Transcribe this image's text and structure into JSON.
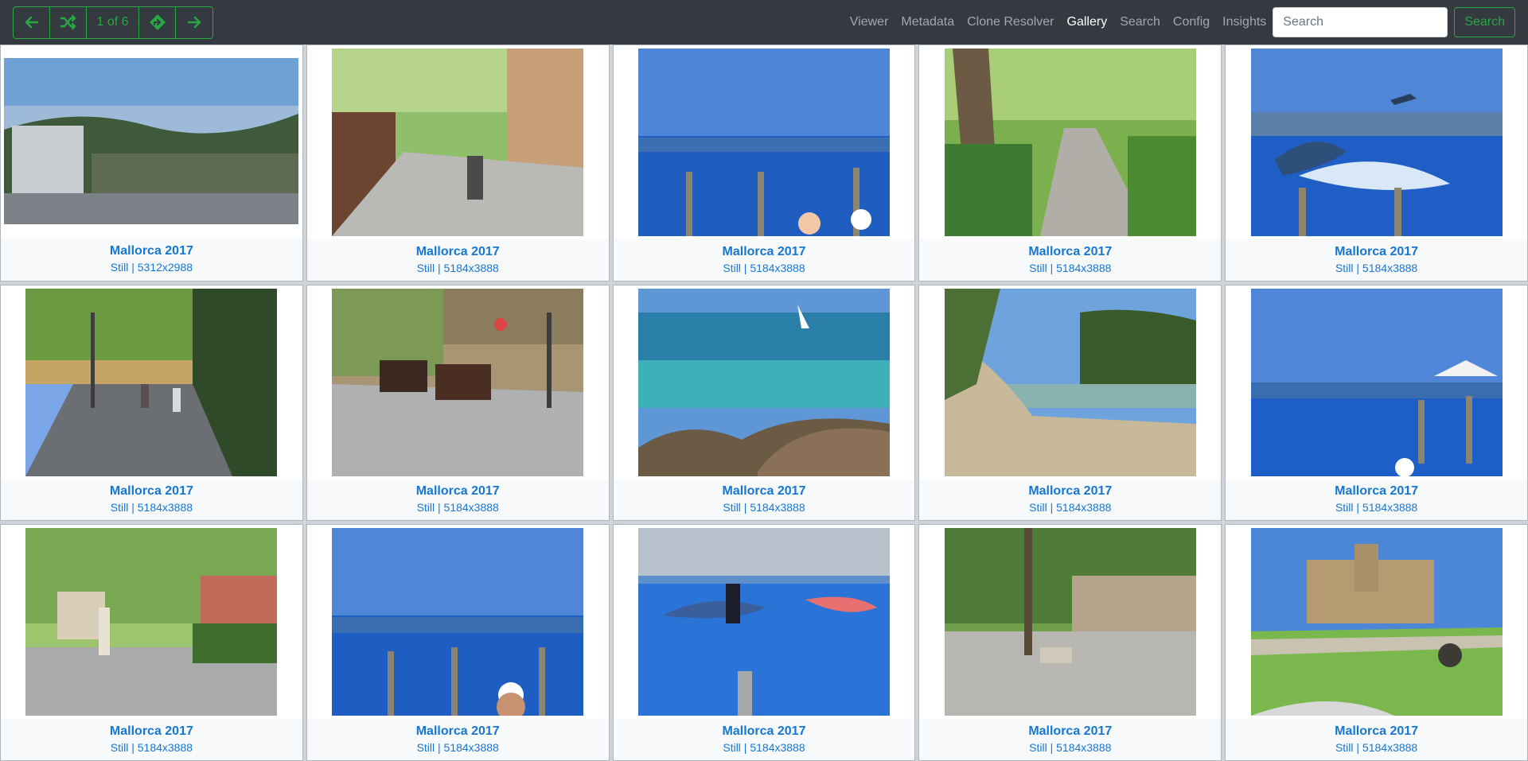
{
  "nav": {
    "page_indicator": "1 of 6",
    "links": [
      "Viewer",
      "Metadata",
      "Clone Resolver",
      "Gallery",
      "Search",
      "Config",
      "Insights"
    ],
    "active_link": "Gallery",
    "search_placeholder": "Search",
    "search_button": "Search",
    "icons": [
      "arrow-left-icon",
      "shuffle-icon",
      "directions-icon",
      "arrow-right-icon"
    ],
    "accent_color": "#28a745"
  },
  "gallery": {
    "items": [
      {
        "title": "Mallorca 2017",
        "subtitle": "Still | 5312x2988",
        "scene": "town-hillside"
      },
      {
        "title": "Mallorca 2017",
        "subtitle": "Still | 5184x3888",
        "scene": "street-arcade"
      },
      {
        "title": "Mallorca 2017",
        "subtitle": "Still | 5184x3888",
        "scene": "dolphin-pool"
      },
      {
        "title": "Mallorca 2017",
        "subtitle": "Still | 5184x3888",
        "scene": "tree-walkway"
      },
      {
        "title": "Mallorca 2017",
        "subtitle": "Still | 5184x3888",
        "scene": "dolphin-jump"
      },
      {
        "title": "Mallorca 2017",
        "subtitle": "Still | 5184x3888",
        "scene": "boulevard"
      },
      {
        "title": "Mallorca 2017",
        "subtitle": "Still | 5184x3888",
        "scene": "horse-carriages"
      },
      {
        "title": "Mallorca 2017",
        "subtitle": "Still | 5184x3888",
        "scene": "rocky-sea"
      },
      {
        "title": "Mallorca 2017",
        "subtitle": "Still | 5184x3888",
        "scene": "cove"
      },
      {
        "title": "Mallorca 2017",
        "subtitle": "Still | 5184x3888",
        "scene": "dolphin-pool-tent"
      },
      {
        "title": "Mallorca 2017",
        "subtitle": "Still | 5184x3888",
        "scene": "plaza-statue"
      },
      {
        "title": "Mallorca 2017",
        "subtitle": "Still | 5184x3888",
        "scene": "dolphin-pool-spectators"
      },
      {
        "title": "Mallorca 2017",
        "subtitle": "Still | 5184x3888",
        "scene": "dolphin-show"
      },
      {
        "title": "Mallorca 2017",
        "subtitle": "Still | 5184x3888",
        "scene": "shaded-square"
      },
      {
        "title": "Mallorca 2017",
        "subtitle": "Still | 5184x3888",
        "scene": "cathedral-park"
      }
    ]
  }
}
